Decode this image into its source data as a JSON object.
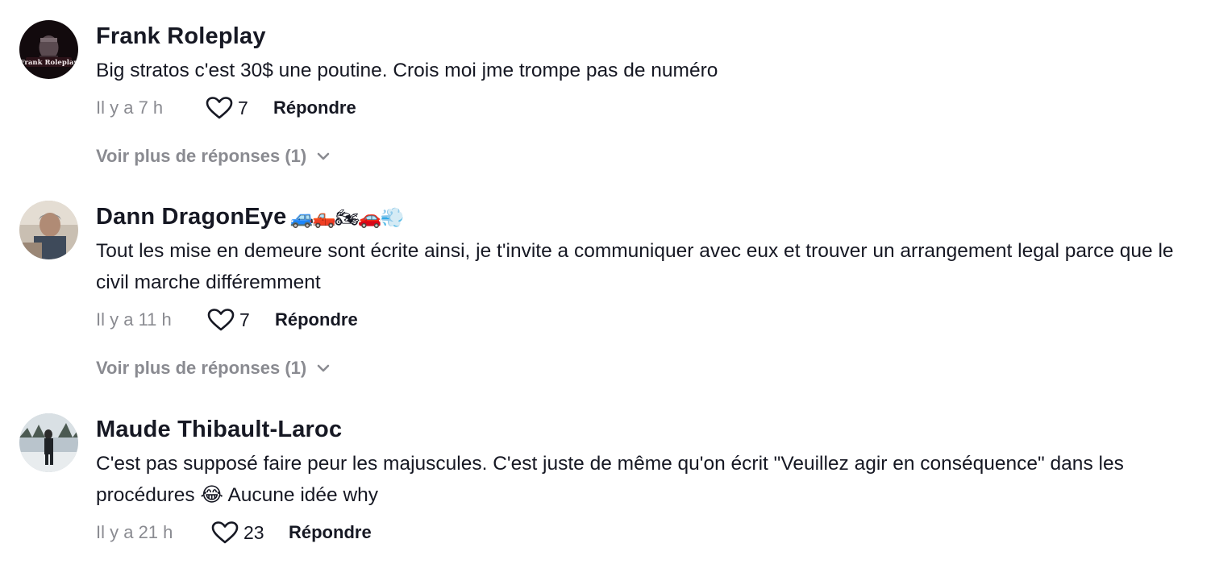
{
  "comments": [
    {
      "username": "Frank Roleplay",
      "username_emoji": "",
      "avatar_text": "Frank Roleplay",
      "text": "Big stratos c'est 30$ une poutine. Crois moi jme trompe pas de numéro",
      "time": "Il y a 7 h",
      "likes": "7",
      "reply_label": "Répondre",
      "more_replies": "Voir plus de réponses (1)"
    },
    {
      "username": "Dann DragonEye",
      "username_emoji": "🚙🛻🏍🚗💨",
      "text": "Tout les mise en demeure sont écrite ainsi, je t'invite a communiquer avec eux et trouver un arrangement legal parce que le civil marche différemment",
      "time": "Il y a 11 h",
      "likes": "7",
      "reply_label": "Répondre",
      "more_replies": "Voir plus de réponses (1)"
    },
    {
      "username": "Maude Thibault-Laroc",
      "username_emoji": "",
      "text": "C'est pas supposé faire peur les majuscules. C'est juste de même qu'on écrit \"Veuillez agir en conséquence\" dans les procédures 😂 Aucune idée why",
      "time": "Il y a 21 h",
      "likes": "23",
      "reply_label": "Répondre"
    }
  ],
  "icons": {
    "like": "heart-outline-icon",
    "expand": "chevron-down-icon"
  },
  "colors": {
    "primary_text": "#161823",
    "secondary_text": "#8a8b91",
    "background": "#ffffff"
  }
}
